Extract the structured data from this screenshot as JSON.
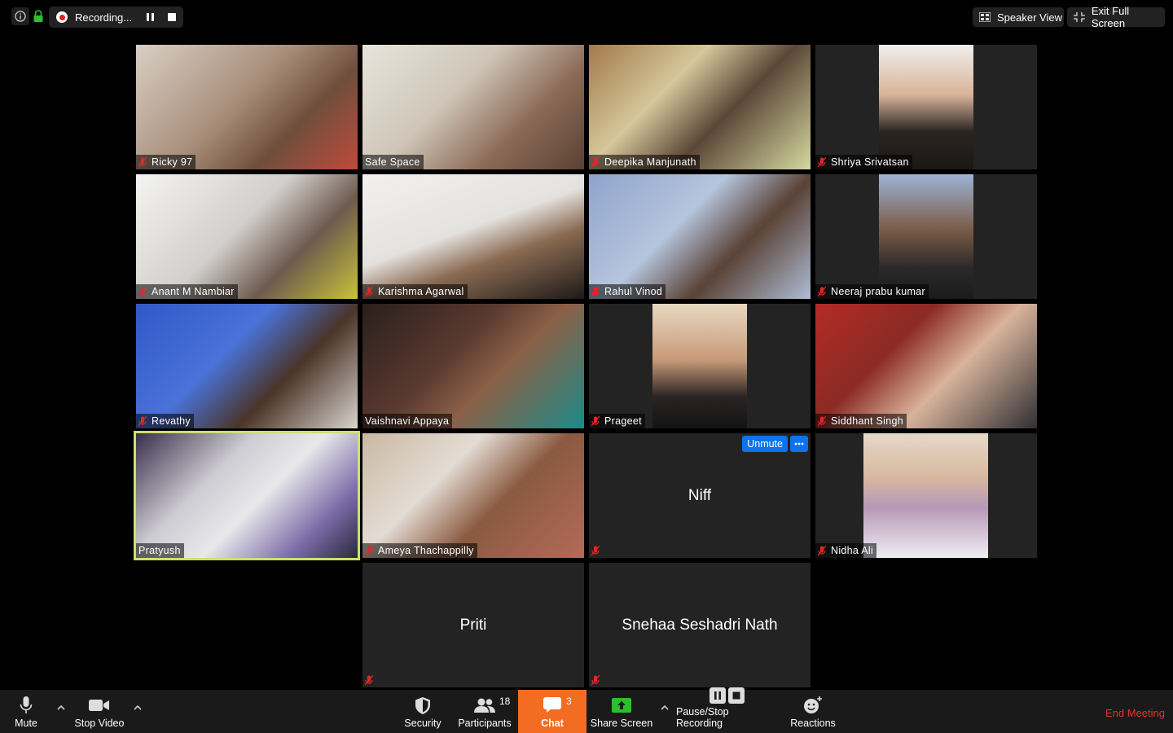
{
  "topbar": {
    "recording_label": "Recording...",
    "speaker_view_label": "Speaker View",
    "exit_fullscreen_label": "Exit Full Screen"
  },
  "participants": [
    {
      "name": "Ricky 97",
      "muted": true
    },
    {
      "name": "Safe Space",
      "muted": false
    },
    {
      "name": "Deepika Manjunath",
      "muted": true
    },
    {
      "name": "Shriya Srivatsan",
      "muted": true
    },
    {
      "name": "Anant M Nambiar",
      "muted": true
    },
    {
      "name": "Karishma Agarwal",
      "muted": true
    },
    {
      "name": "Rahul Vinod",
      "muted": true
    },
    {
      "name": "Neeraj prabu kumar",
      "muted": true
    },
    {
      "name": "Revathy",
      "muted": true
    },
    {
      "name": "Vaishnavi Appaya",
      "muted": false
    },
    {
      "name": "Prageet",
      "muted": true
    },
    {
      "name": "Siddhant Singh",
      "muted": true
    },
    {
      "name": "Pratyush",
      "muted": false,
      "active_speaker": true
    },
    {
      "name": "Ameya Thachappilly",
      "muted": true
    },
    {
      "name": "Niff",
      "muted": true,
      "video_off": true,
      "unmute_label": "Unmute"
    },
    {
      "name": "Nidha Ali",
      "muted": true
    },
    {
      "name": "Priti",
      "muted": true,
      "video_off": true
    },
    {
      "name": "Snehaa Seshadri Nath",
      "muted": true,
      "video_off": true
    }
  ],
  "toolbar": {
    "mute_label": "Mute",
    "stop_video_label": "Stop Video",
    "security_label": "Security",
    "participants_label": "Participants",
    "participants_count": "18",
    "chat_label": "Chat",
    "chat_count": "3",
    "share_screen_label": "Share Screen",
    "pause_recording_label": "Pause/Stop Recording",
    "reactions_label": "Reactions",
    "end_meeting_label": "End Meeting"
  },
  "colors": {
    "chat_active": "#f26d21",
    "end_meeting": "#e5312a",
    "active_speaker": "#c8e36e",
    "unmute": "#0e72ed",
    "share_green": "#2dbf2d"
  }
}
